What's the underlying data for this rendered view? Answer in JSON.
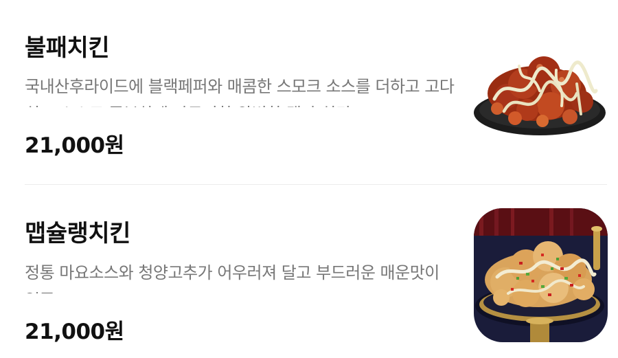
{
  "menu": {
    "items": [
      {
        "name": "불패치킨",
        "description": "국내산후라이드에 블랙페퍼와 매콤한 스모크 소스를 더하고 고다치즈 소스로 풍부하게 마무리한 완벽한 맵단 치킨!",
        "price": "21,000원",
        "image_icon": "spicy-glazed-chicken-photo"
      },
      {
        "name": "맵슐랭치킨",
        "description": "정통 마요소스와 청양고추가 어우러져 달고 부드러운 매운맛이 일품!",
        "price": "21,000원",
        "image_icon": "mayo-chili-chicken-photo"
      }
    ]
  }
}
